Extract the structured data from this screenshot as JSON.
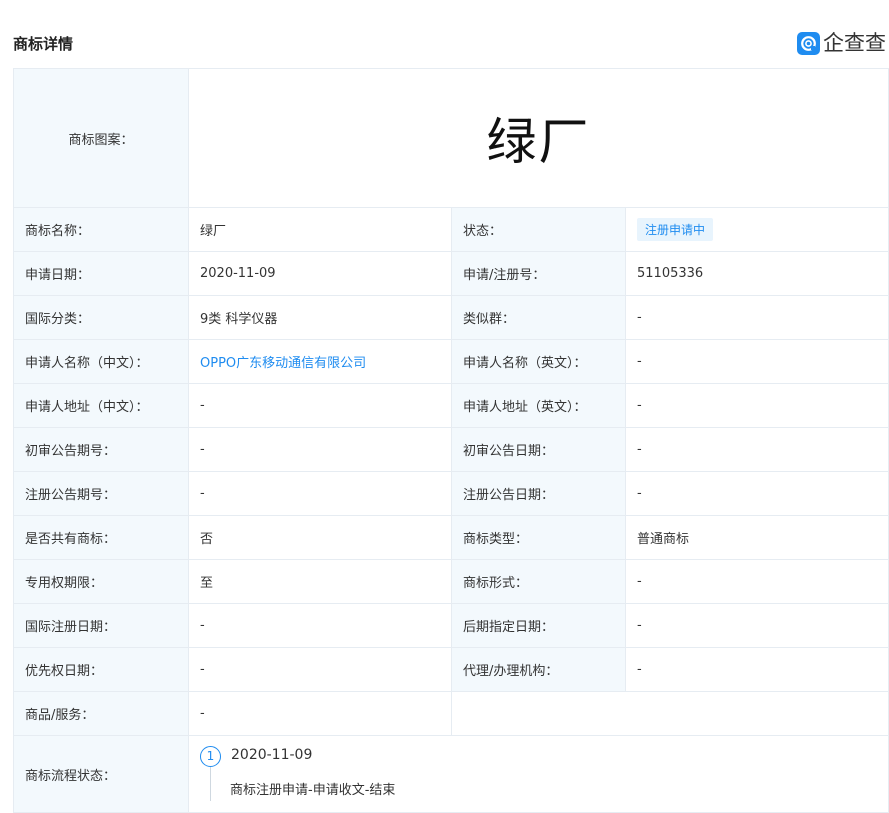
{
  "header": {
    "title": "商标详情",
    "brand_name": "企查查",
    "brand_color": "#1f8cf0"
  },
  "logo": {
    "label": "商标图案：",
    "image_text": "绿厂"
  },
  "rows": [
    {
      "l1": "商标名称：",
      "v1": "绿厂",
      "l2": "状态：",
      "v2": "注册申请中"
    },
    {
      "l1": "申请日期：",
      "v1": "2020-11-09",
      "l2": "申请/注册号：",
      "v2": "51105336"
    },
    {
      "l1": "国际分类：",
      "v1": "9类 科学仪器",
      "l2": "类似群：",
      "v2": "-"
    },
    {
      "l1": "申请人名称（中文）：",
      "v1": "OPPO广东移动通信有限公司",
      "l2": "申请人名称（英文）：",
      "v2": "-"
    },
    {
      "l1": "申请人地址（中文）：",
      "v1": "-",
      "l2": "申请人地址（英文）：",
      "v2": "-"
    },
    {
      "l1": "初审公告期号：",
      "v1": "-",
      "l2": "初审公告日期：",
      "v2": "-"
    },
    {
      "l1": "注册公告期号：",
      "v1": "-",
      "l2": "注册公告日期：",
      "v2": "-"
    },
    {
      "l1": "是否共有商标：",
      "v1": "否",
      "l2": "商标类型：",
      "v2": "普通商标"
    },
    {
      "l1": "专用权期限：",
      "v1": "至",
      "l2": "商标形式：",
      "v2": "-"
    },
    {
      "l1": "国际注册日期：",
      "v1": "-",
      "l2": "后期指定日期：",
      "v2": "-"
    },
    {
      "l1": "优先权日期：",
      "v1": "-",
      "l2": "代理/办理机构：",
      "v2": "-"
    }
  ],
  "goods": {
    "label": "商品/服务：",
    "value": "-"
  },
  "flow": {
    "label": "商标流程状态：",
    "steps": [
      {
        "num": "1",
        "date": "2020-11-09",
        "desc": "商标注册申请-申请收文-结束"
      }
    ]
  }
}
